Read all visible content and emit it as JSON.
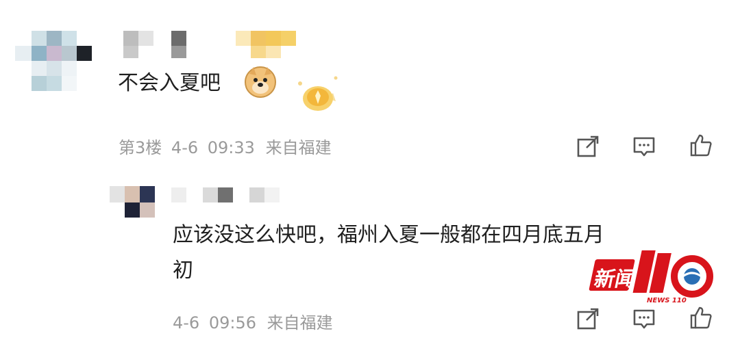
{
  "comments": [
    {
      "text": "不会入夏吧",
      "emoji": "doge-emoji",
      "floor": "第3楼",
      "date": "4-6",
      "time": "09:33",
      "location": "来自福建"
    }
  ],
  "reply": {
    "text_line1": "应该没这么快吧，福州入夏一般都在四月底五月",
    "text_line2": "初",
    "date": "4-6",
    "time": "09:56",
    "location": "来自福建"
  },
  "actions": {
    "share_icon": "share-icon",
    "reply_icon": "comment-icon",
    "like_icon": "thumbs-up-icon"
  },
  "watermark": {
    "logo_text": "新闻110",
    "sub_text": "NEWS 110"
  },
  "colors": {
    "meta_text": "#9a9a9a",
    "badge_gold": "#f3c64a",
    "watermark_red": "#d8141b"
  }
}
